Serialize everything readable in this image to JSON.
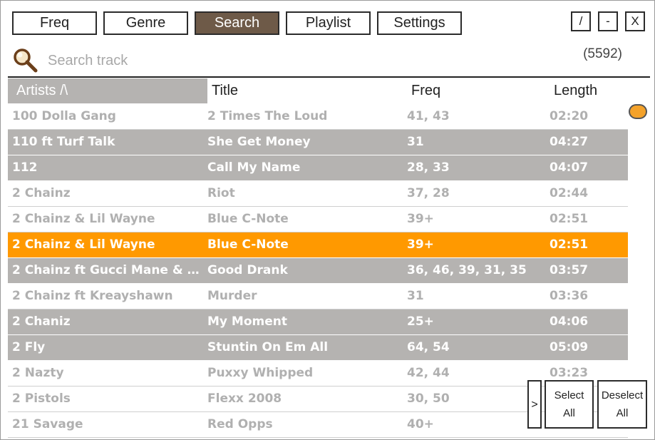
{
  "tabs": [
    {
      "label": "Freq"
    },
    {
      "label": "Genre"
    },
    {
      "label": "Search"
    },
    {
      "label": "Playlist"
    },
    {
      "label": "Settings"
    }
  ],
  "active_tab": "Search",
  "window_buttons": {
    "edit": "/",
    "minimize": "-",
    "close": "X"
  },
  "search": {
    "placeholder": "Search track",
    "value": "",
    "count": "(5592)"
  },
  "colors": {
    "accent": "#ff9900",
    "active_tab": "#6e5a48",
    "row_grey": "#b5b3b1",
    "text_light": "#b0b0b0"
  },
  "columns": {
    "artist": "Artists /\\",
    "title": "Title",
    "freq": "Freq",
    "length": "Length"
  },
  "rows": [
    {
      "artist": "100 Dolla Gang",
      "title": "2 Times The Loud",
      "freq": "41, 43",
      "length": "02:20",
      "style": "light"
    },
    {
      "artist": "110 ft Turf Talk",
      "title": "She Get Money",
      "freq": "31",
      "length": "04:27",
      "style": "grey"
    },
    {
      "artist": "112",
      "title": "Call My Name",
      "freq": "28, 33",
      "length": "04:07",
      "style": "grey"
    },
    {
      "artist": "2 Chainz",
      "title": "Riot",
      "freq": "37, 28",
      "length": "02:44",
      "style": "light"
    },
    {
      "artist": "2 Chainz & Lil Wayne",
      "title": "Blue C-Note",
      "freq": "39+",
      "length": "02:51",
      "style": "light"
    },
    {
      "artist": "2 Chainz & Lil Wayne",
      "title": "Blue C-Note",
      "freq": "39+",
      "length": "02:51",
      "style": "sel"
    },
    {
      "artist": "2 Chainz ft Gucci Mane & Qu...",
      "title": "Good Drank",
      "freq": "36, 46, 39, 31, 35",
      "length": "03:57",
      "style": "grey"
    },
    {
      "artist": "2 Chainz ft Kreayshawn",
      "title": "Murder",
      "freq": "31",
      "length": "03:36",
      "style": "light"
    },
    {
      "artist": "2 Chaniz",
      "title": "My Moment",
      "freq": "25+",
      "length": "04:06",
      "style": "grey"
    },
    {
      "artist": "2 Fly",
      "title": "Stuntin On Em All",
      "freq": "64, 54",
      "length": "05:09",
      "style": "grey"
    },
    {
      "artist": "2 Nazty",
      "title": "Puxxy Whipped",
      "freq": "42, 44",
      "length": "03:23",
      "style": "light"
    },
    {
      "artist": "2 Pistols",
      "title": "Flexx 2008",
      "freq": "30, 50",
      "length": "",
      "style": "light"
    },
    {
      "artist": "21 Savage",
      "title": "Red Opps",
      "freq": "40+",
      "length": "",
      "style": "light"
    }
  ],
  "bottom_buttons": {
    "expand": ">",
    "select_all": {
      "line1": "Select",
      "line2": "All"
    },
    "deselect_all": {
      "line1": "Deselect",
      "line2": "All"
    }
  },
  "icons": {
    "search": "magnifier-icon",
    "scroll": "scroll-thumb"
  }
}
